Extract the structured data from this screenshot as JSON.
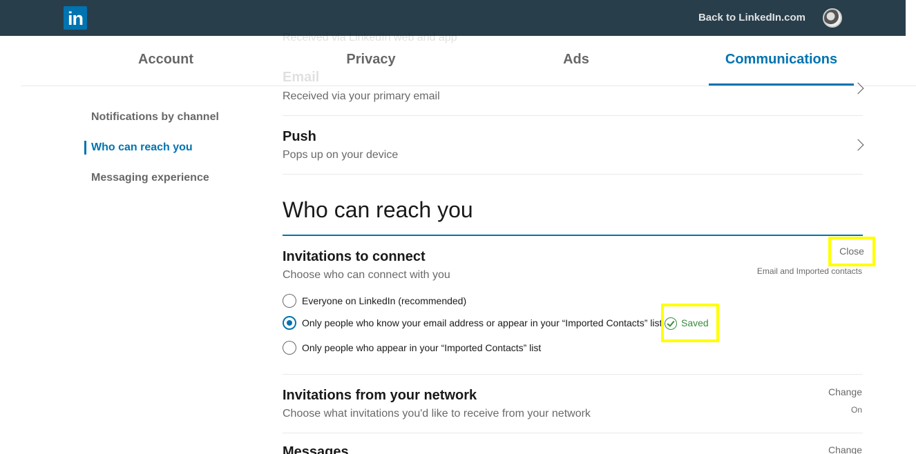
{
  "header": {
    "logo_text": "in",
    "back_link": "Back to LinkedIn.com"
  },
  "tabs": [
    {
      "label": "Account"
    },
    {
      "label": "Privacy"
    },
    {
      "label": "Ads"
    },
    {
      "label": "Communications"
    }
  ],
  "sidebar": {
    "items": [
      {
        "label": "Notifications by channel"
      },
      {
        "label": "Who can reach you"
      },
      {
        "label": "Messaging experience"
      }
    ]
  },
  "channels": {
    "ghost_sub": "Received via LinkedIn web and app",
    "email_title": "Email",
    "email_sub": "Received via your primary email",
    "push_title": "Push",
    "push_sub": "Pops up on your device"
  },
  "reach": {
    "title": "Who can reach you",
    "invitations": {
      "title": "Invitations to connect",
      "subtitle": "Choose who can connect with you",
      "close_label": "Close",
      "current_value": "Email and Imported contacts",
      "options": [
        {
          "label": "Everyone on LinkedIn (recommended)",
          "checked": false
        },
        {
          "label": "Only people who know your email address or appear in your “Imported Contacts” list",
          "checked": true
        },
        {
          "label": "Only people who appear in your “Imported Contacts” list",
          "checked": false
        }
      ],
      "saved_label": "Saved"
    },
    "network": {
      "title": "Invitations from your network",
      "subtitle": "Choose what invitations you'd like to receive from your network",
      "change_label": "Change",
      "value": "On"
    },
    "messages": {
      "title": "Messages",
      "change_label": "Change"
    }
  },
  "colors": {
    "brand": "#0073b1",
    "topbar": "#283e4a",
    "saved": "#398b3b",
    "highlight": "#ffff00"
  }
}
